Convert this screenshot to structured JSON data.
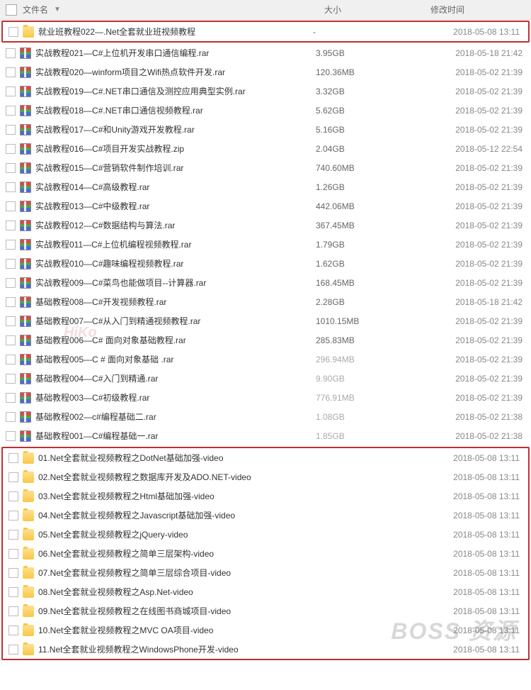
{
  "header": {
    "name": "文件名",
    "size": "大小",
    "date": "修改时间"
  },
  "hl1": {
    "type": "folder",
    "name": "就业班教程022—.Net全套就业班视频教程",
    "size": "-",
    "date": "2018-05-08 13:11"
  },
  "rows": [
    {
      "type": "rar",
      "name": "实战教程021—C#上位机开发串口通信编程.rar",
      "size": "3.95GB",
      "date": "2018-05-18 21:42"
    },
    {
      "type": "rar",
      "name": "实战教程020—winform项目之Wifi热点软件开发.rar",
      "size": "120.36MB",
      "date": "2018-05-02 21:39"
    },
    {
      "type": "rar",
      "name": "实战教程019—C#.NET串口通信及测控应用典型实例.rar",
      "size": "3.32GB",
      "date": "2018-05-02 21:39"
    },
    {
      "type": "rar",
      "name": "实战教程018—C#.NET串口通信视频教程.rar",
      "size": "5.62GB",
      "date": "2018-05-02 21:39"
    },
    {
      "type": "rar",
      "name": "实战教程017—C#和Unity游戏开发教程.rar",
      "size": "5.16GB",
      "date": "2018-05-02 21:39"
    },
    {
      "type": "rar",
      "name": "实战教程016—C#项目开发实战教程.zip",
      "size": "2.04GB",
      "date": "2018-05-12 22:54"
    },
    {
      "type": "rar",
      "name": "实战教程015—C#营销软件制作培训.rar",
      "size": "740.60MB",
      "date": "2018-05-02 21:39"
    },
    {
      "type": "rar",
      "name": "实战教程014—C#高级教程.rar",
      "size": "1.26GB",
      "date": "2018-05-02 21:39"
    },
    {
      "type": "rar",
      "name": "实战教程013—C#中级教程.rar",
      "size": "442.06MB",
      "date": "2018-05-02 21:39"
    },
    {
      "type": "rar",
      "name": "实战教程012—C#数据结构与算法.rar",
      "size": "367.45MB",
      "date": "2018-05-02 21:39"
    },
    {
      "type": "rar",
      "name": "实战教程011—C#上位机编程视频教程.rar",
      "size": "1.79GB",
      "date": "2018-05-02 21:39"
    },
    {
      "type": "rar",
      "name": "实战教程010—C#趣味编程视频教程.rar",
      "size": "1.62GB",
      "date": "2018-05-02 21:39"
    },
    {
      "type": "rar",
      "name": "实战教程009—C#菜鸟也能做项目--计算器.rar",
      "size": "168.45MB",
      "date": "2018-05-02 21:39"
    },
    {
      "type": "rar",
      "name": "基础教程008—C#开发视频教程.rar",
      "size": "2.28GB",
      "date": "2018-05-18 21:42"
    },
    {
      "type": "rar",
      "name": "基础教程007—C#从入门到精通视频教程.rar",
      "size": "1010.15MB",
      "date": "2018-05-02 21:39"
    },
    {
      "type": "rar",
      "name": "基础教程006—C# 面向对象基础教程.rar",
      "size": "285.83MB",
      "date": "2018-05-02 21:39"
    },
    {
      "type": "rar",
      "name": "基础教程005—C # 面向对象基础 .rar",
      "size": "296.94MB",
      "faded": true,
      "date": "2018-05-02 21:39"
    },
    {
      "type": "rar",
      "name": "基础教程004—C#入门到精通.rar",
      "size": "9.90GB",
      "faded": true,
      "date": "2018-05-02 21:39"
    },
    {
      "type": "rar",
      "name": "基础教程003—C#初级教程.rar",
      "size": "776.91MB",
      "faded": true,
      "date": "2018-05-02 21:39"
    },
    {
      "type": "rar",
      "name": "基础教程002—c#编程基础二.rar",
      "size": "1.08GB",
      "faded": true,
      "date": "2018-05-02 21:38"
    },
    {
      "type": "rar",
      "name": "基础教程001—C#编程基础一.rar",
      "size": "1.85GB",
      "faded": true,
      "date": "2018-05-02 21:38"
    }
  ],
  "hl2": [
    {
      "type": "folder",
      "name": "01.Net全套就业视频教程之DotNet基础加强-video",
      "size": "",
      "date": "2018-05-08 13:11"
    },
    {
      "type": "folder",
      "name": "02.Net全套就业视频教程之数据库开发及ADO.NET-video",
      "size": "",
      "date": "2018-05-08 13:11"
    },
    {
      "type": "folder",
      "name": "03.Net全套就业视频教程之Html基础加强-video",
      "size": "",
      "date": "2018-05-08 13:11"
    },
    {
      "type": "folder",
      "name": "04.Net全套就业视频教程之Javascript基础加强-video",
      "size": "",
      "date": "2018-05-08 13:11"
    },
    {
      "type": "folder",
      "name": "05.Net全套就业视频教程之jQuery-video",
      "size": "",
      "date": "2018-05-08 13:11"
    },
    {
      "type": "folder",
      "name": "06.Net全套就业视频教程之简单三层架构-video",
      "size": "",
      "date": "2018-05-08 13:11"
    },
    {
      "type": "folder",
      "name": "07.Net全套就业视频教程之简单三层综合项目-video",
      "size": "",
      "date": "2018-05-08 13:11"
    },
    {
      "type": "folder",
      "name": "08.Net全套就业视频教程之Asp.Net-video",
      "size": "",
      "date": "2018-05-08 13:11"
    },
    {
      "type": "folder",
      "name": "09.Net全套就业视频教程之在线图书商城项目-video",
      "size": "",
      "date": "2018-05-08 13:11"
    },
    {
      "type": "folder",
      "name": "10.Net全套就业视频教程之MVC OA项目-video",
      "size": "",
      "date": "2018-05-08 13:11"
    },
    {
      "type": "folder",
      "name": "11.Net全套就业视频教程之WindowsPhone开发-video",
      "size": "",
      "date": "2018-05-08 13:11"
    }
  ],
  "watermark": "BOSS 资源",
  "watermark2": "HiKo"
}
